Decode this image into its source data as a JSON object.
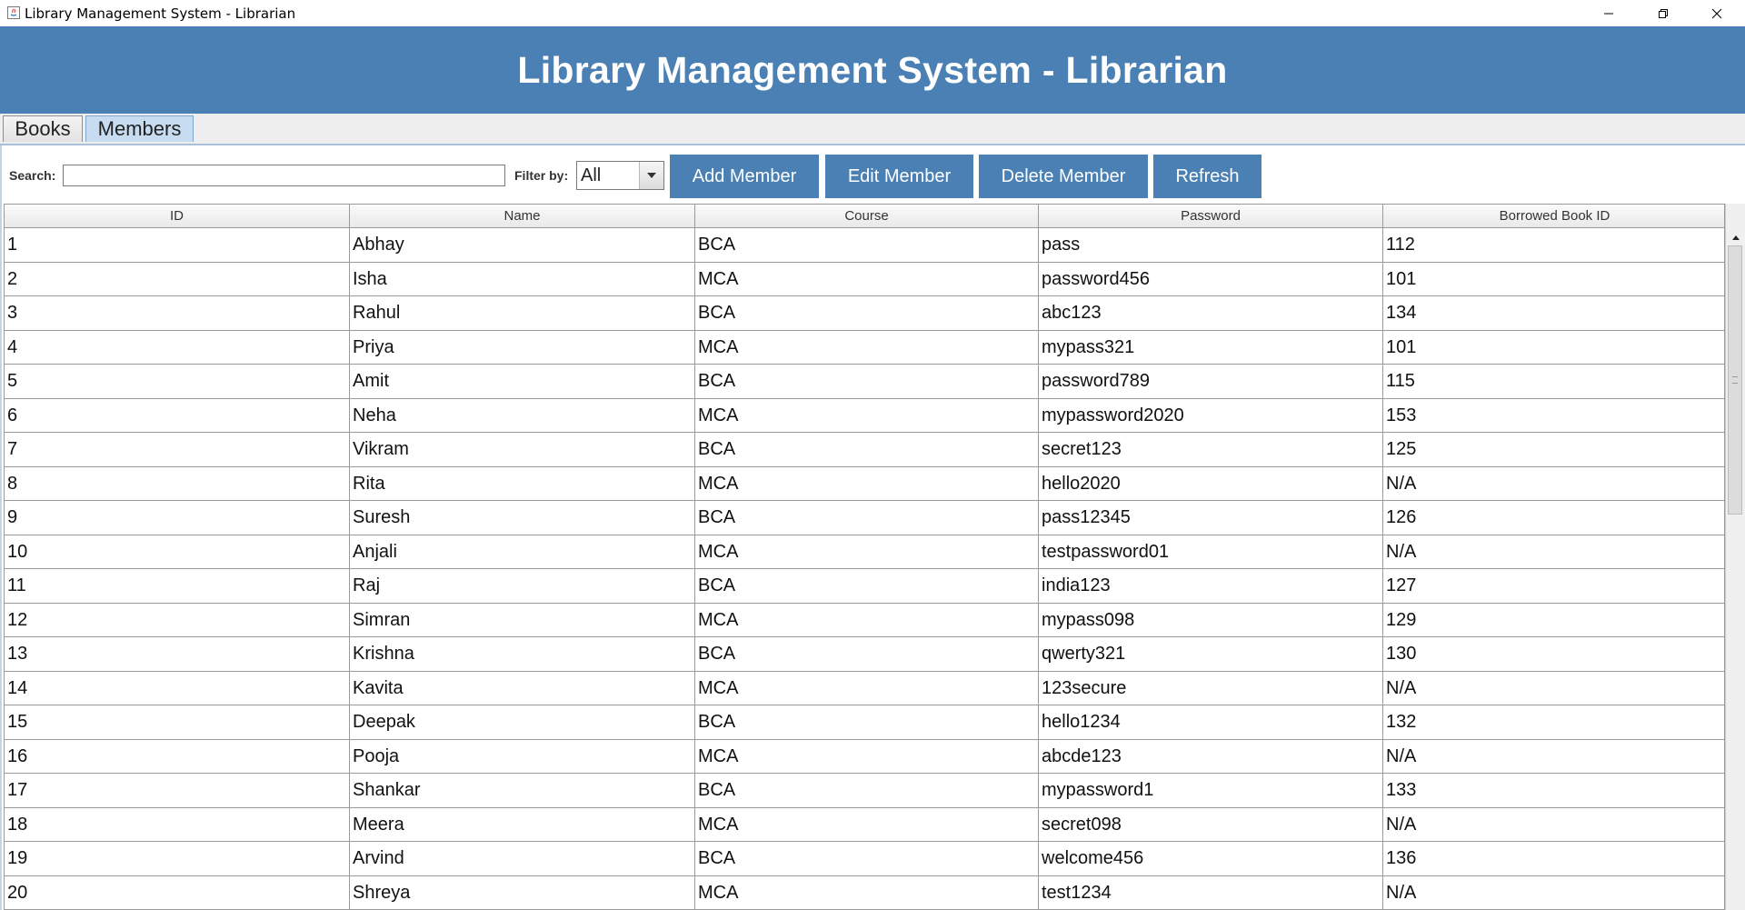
{
  "window": {
    "title": "Library Management System - Librarian"
  },
  "header": {
    "title": "Library Management System - Librarian",
    "background": "#4a80b3"
  },
  "tabs": [
    {
      "label": "Books",
      "selected": false
    },
    {
      "label": "Members",
      "selected": true
    }
  ],
  "toolbar": {
    "search_label": "Search:",
    "search_value": "",
    "filter_label": "Filter by:",
    "filter_value": "All",
    "add_label": "Add Member",
    "edit_label": "Edit Member",
    "delete_label": "Delete Member",
    "refresh_label": "Refresh"
  },
  "table": {
    "columns": [
      "ID",
      "Name",
      "Course",
      "Password",
      "Borrowed Book ID"
    ],
    "rows": [
      [
        "1",
        "Abhay",
        "BCA",
        "pass",
        "112"
      ],
      [
        "2",
        "Isha",
        "MCA",
        "password456",
        "101"
      ],
      [
        "3",
        "Rahul",
        "BCA",
        "abc123",
        "134"
      ],
      [
        "4",
        "Priya",
        "MCA",
        "mypass321",
        "101"
      ],
      [
        "5",
        "Amit",
        "BCA",
        "password789",
        "115"
      ],
      [
        "6",
        "Neha",
        "MCA",
        "mypassword2020",
        "153"
      ],
      [
        "7",
        "Vikram",
        "BCA",
        "secret123",
        "125"
      ],
      [
        "8",
        "Rita",
        "MCA",
        "hello2020",
        "N/A"
      ],
      [
        "9",
        "Suresh",
        "BCA",
        "pass12345",
        "126"
      ],
      [
        "10",
        "Anjali",
        "MCA",
        "testpassword01",
        "N/A"
      ],
      [
        "11",
        "Raj",
        "BCA",
        "india123",
        "127"
      ],
      [
        "12",
        "Simran",
        "MCA",
        "mypass098",
        "129"
      ],
      [
        "13",
        "Krishna",
        "BCA",
        "qwerty321",
        "130"
      ],
      [
        "14",
        "Kavita",
        "MCA",
        "123secure",
        "N/A"
      ],
      [
        "15",
        "Deepak",
        "BCA",
        "hello1234",
        "132"
      ],
      [
        "16",
        "Pooja",
        "MCA",
        "abcde123",
        "N/A"
      ],
      [
        "17",
        "Shankar",
        "BCA",
        "mypassword1",
        "133"
      ],
      [
        "18",
        "Meera",
        "MCA",
        "secret098",
        "N/A"
      ],
      [
        "19",
        "Arvind",
        "BCA",
        "welcome456",
        "136"
      ],
      [
        "20",
        "Shreya",
        "MCA",
        "test1234",
        "N/A"
      ]
    ]
  }
}
